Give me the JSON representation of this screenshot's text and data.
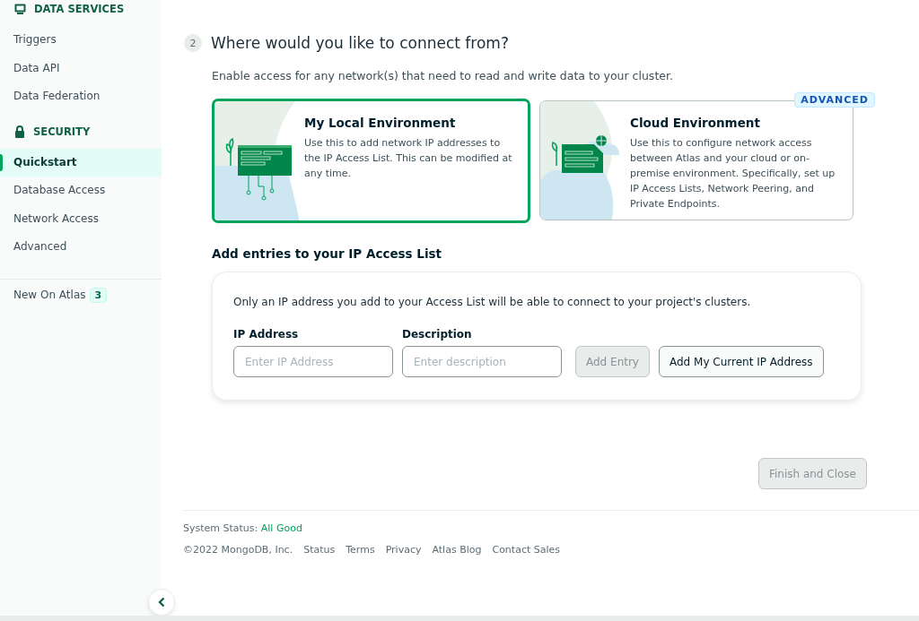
{
  "sidebar": {
    "sections": [
      {
        "title": "DATA SERVICES",
        "kind": "services",
        "items": [
          {
            "label": "Triggers",
            "selected": false
          },
          {
            "label": "Data API",
            "selected": false
          },
          {
            "label": "Data Federation",
            "selected": false
          }
        ]
      },
      {
        "title": "SECURITY",
        "kind": "security",
        "items": [
          {
            "label": "Quickstart",
            "selected": true
          },
          {
            "label": "Database Access",
            "selected": false
          },
          {
            "label": "Network Access",
            "selected": false
          },
          {
            "label": "Advanced",
            "selected": false
          }
        ]
      }
    ],
    "footer_item": {
      "label": "New On Atlas",
      "badge": "3"
    }
  },
  "step": {
    "number": "2",
    "title": "Where would you like to connect from?",
    "intro": "Enable access for any network(s) that need to read and write data to your cluster.",
    "options": [
      {
        "kind": "local",
        "title": "My Local Environment",
        "description": "Use this to add network IP addresses to the IP Access List. This can be modified at any time.",
        "selected": true
      },
      {
        "kind": "cloud",
        "title": "Cloud Environment",
        "description": "Use this to configure network access between Atlas and your cloud or on-premise environment. Specifically, set up IP Access Lists, Network Peering, and Private Endpoints.",
        "selected": false,
        "badge": "ADVANCED"
      }
    ]
  },
  "access_list": {
    "title": "Add entries to your IP Access List",
    "note": "Only an IP address you add to your Access List will be able to connect to your project's clusters.",
    "fields": [
      {
        "label": "IP Address",
        "placeholder": "Enter IP Address"
      },
      {
        "label": "Description",
        "placeholder": "Enter description"
      }
    ],
    "buttons": [
      {
        "label": "Add Entry",
        "disabled": true
      },
      {
        "label": "Add My Current IP Address",
        "disabled": false
      }
    ]
  },
  "finish_button": {
    "label": "Finish and Close",
    "disabled": true
  },
  "footer": {
    "status_label": "System Status:",
    "status_value": "All Good",
    "copyright": "©2022 MongoDB, Inc.",
    "links": [
      "Status",
      "Terms",
      "Privacy",
      "Atlas Blog",
      "Contact Sales"
    ]
  }
}
